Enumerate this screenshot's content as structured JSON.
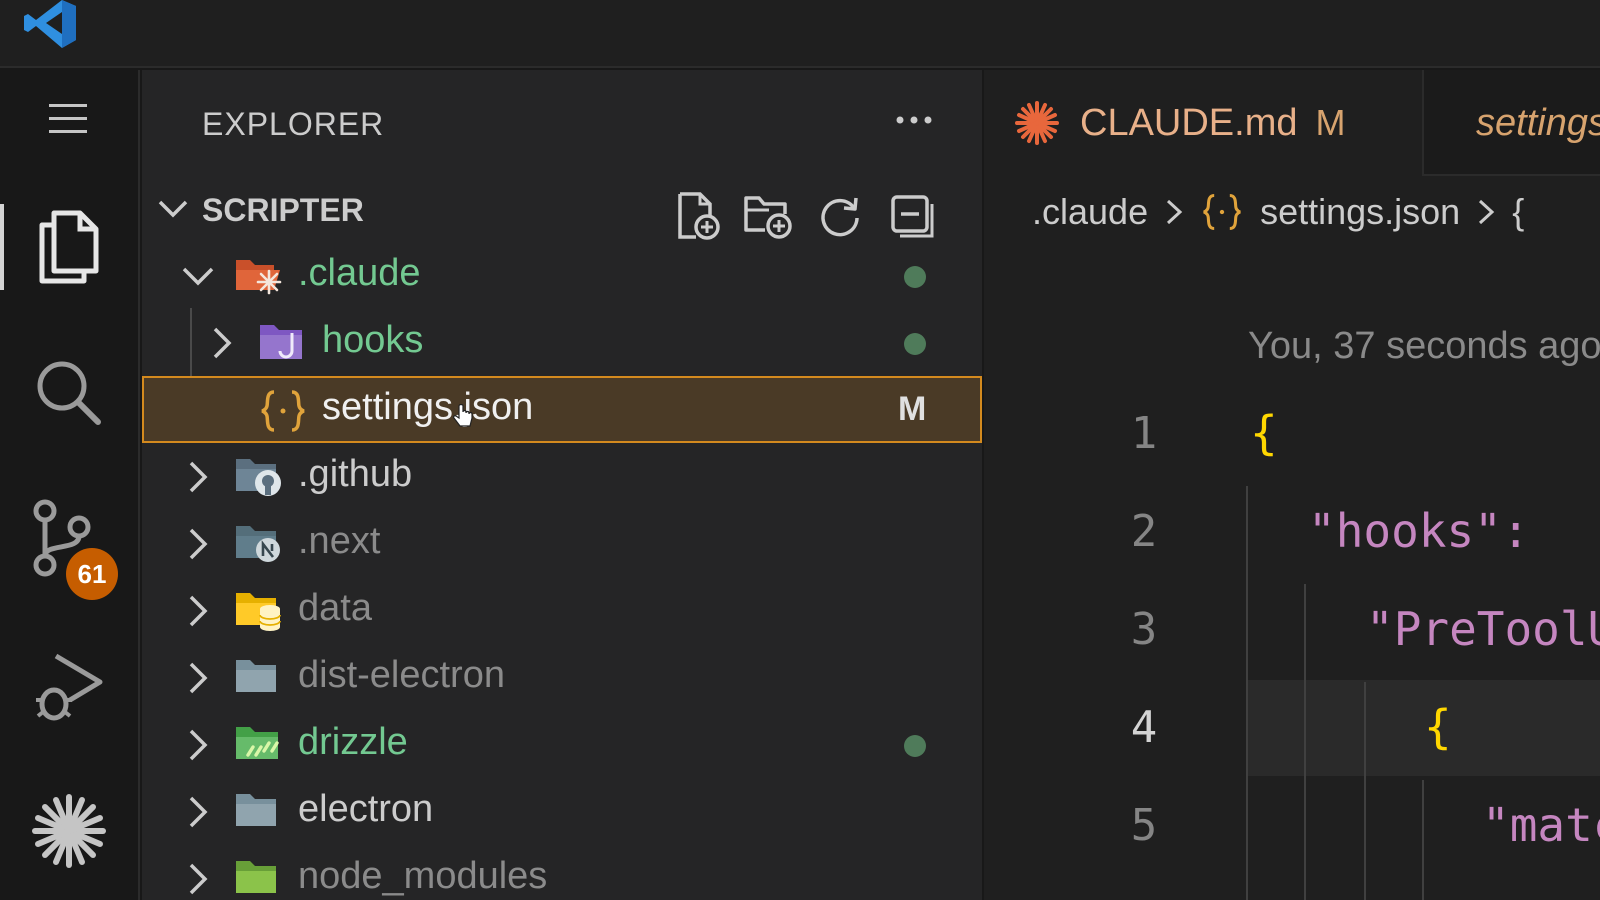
{
  "titlebar": {
    "logo_icon": "vscode-logo-icon"
  },
  "activity_bar": {
    "items": [
      {
        "id": "menu",
        "icon": "hamburger-menu-icon"
      },
      {
        "id": "explorer",
        "icon": "files-icon",
        "active": true
      },
      {
        "id": "search",
        "icon": "search-icon"
      },
      {
        "id": "source-control",
        "icon": "source-control-icon",
        "badge": "61"
      },
      {
        "id": "run-debug",
        "icon": "run-debug-icon"
      },
      {
        "id": "claude",
        "icon": "claude-sparkle-icon"
      }
    ]
  },
  "explorer": {
    "title": "EXPLORER",
    "more_icon": "ellipsis-icon",
    "section": {
      "title": "SCRIPTER",
      "actions": [
        "new-file-icon",
        "new-folder-icon",
        "refresh-icon",
        "collapse-all-icon"
      ]
    },
    "tree": [
      {
        "label": ".claude",
        "expanded": true,
        "color": "#73c991",
        "status": "dot"
      },
      {
        "label": "hooks",
        "expanded": false,
        "color": "#73c991",
        "status": "dot"
      },
      {
        "label": "settings.json",
        "color": "#e8e8e8",
        "status": "M",
        "selected": true
      },
      {
        "label": ".github",
        "expanded": false,
        "color": "#cccccc"
      },
      {
        "label": ".next",
        "expanded": false,
        "color": "#8b8b8b"
      },
      {
        "label": "data",
        "expanded": false,
        "color": "#8b8b8b"
      },
      {
        "label": "dist-electron",
        "expanded": false,
        "color": "#8b8b8b"
      },
      {
        "label": "drizzle",
        "expanded": false,
        "color": "#73c991",
        "status": "dot"
      },
      {
        "label": "electron",
        "expanded": false,
        "color": "#cccccc"
      },
      {
        "label": "node_modules",
        "expanded": false,
        "color": "#8b8b8b"
      }
    ]
  },
  "editor": {
    "tabs": [
      {
        "label": "CLAUDE.md",
        "mark": "M",
        "icon": "claude-sparkle-icon",
        "active": false
      },
      {
        "label": "settings.json",
        "icon": "json-braces-icon",
        "active": true
      }
    ],
    "breadcrumb": [
      ".claude",
      "settings.json",
      "{"
    ],
    "codelens": "You, 37 seconds ago",
    "lines": [
      {
        "number": "1",
        "text": "{"
      },
      {
        "number": "2",
        "text": "\"hooks\":"
      },
      {
        "number": "3",
        "text": "\"PreToolUse\""
      },
      {
        "number": "4",
        "text": "{",
        "current": true
      },
      {
        "number": "5",
        "text": "\"matcher\""
      }
    ]
  },
  "colors": {
    "accent_selected_border": "#d48a1e",
    "badge": "#c65d00",
    "git_added": "#73c991"
  }
}
